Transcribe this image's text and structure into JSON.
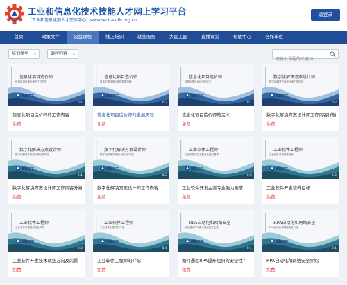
{
  "header": {
    "title": "工业和信息化技术技能人才网上学习平台",
    "subtitle": "（工业和信息化部人才交流中心）www.tech-skills.org.cn",
    "login_label": "请登录"
  },
  "nav": {
    "items": [
      "首页",
      "政策文件",
      "公益课程",
      "线上培训",
      "就业服务",
      "大国工匠",
      "直播课堂",
      "帮助中心",
      "合作单位"
    ],
    "active_index": 2
  },
  "filter": {
    "category": "培训类型",
    "content": "课程内容",
    "search_placeholder": "请输入课程的关键词"
  },
  "courses": [
    {
      "title": "信息化项目造价师的工作内容",
      "price": "免费",
      "thumb_title": "信息化项目造价师",
      "thumb_sub": "信息化项目造价师的工作内容",
      "brand": "网联天下",
      "duration": "0:1",
      "theme": "blue",
      "highlight": false
    },
    {
      "title": "信息化项目造价师的发展历程",
      "price": "免费",
      "thumb_title": "信息化项目造价师",
      "thumb_sub": "信息化项目造价师的发展历程",
      "brand": "网联天下",
      "duration": "0:2",
      "theme": "blue",
      "highlight": true
    },
    {
      "title": "信息化项目造价师的定义",
      "price": "免费",
      "thumb_title": "信息化项目造价师",
      "thumb_sub": "信息化项目造价师的定义",
      "brand": "网联天下",
      "duration": "0:1",
      "theme": "blue",
      "highlight": false
    },
    {
      "title": "数字化解决方案设计师工作内容详解",
      "price": "免费",
      "thumb_title": "数字化解决方案设计师",
      "thumb_sub": "数字化解决方案设计师工作内容",
      "brand": "网联天下",
      "duration": "0:2",
      "theme": "blue",
      "highlight": false
    },
    {
      "title": "数字化解决方案设计师工作内容分析",
      "price": "免费",
      "thumb_title": "数字化解决方案设计师",
      "thumb_sub": "数字化解决方案设计师工作内容",
      "brand": "网联天下",
      "duration": "0:1",
      "theme": "teal",
      "highlight": false
    },
    {
      "title": "数字化解决方案设计师工作内容",
      "price": "免费",
      "thumb_title": "数字化解决方案设计师",
      "thumb_sub": "数字化解决方案设计师工作内容",
      "brand": "网联天下",
      "duration": "0:2",
      "theme": "teal",
      "highlight": false
    },
    {
      "title": "工业软件开发主要专业能力要求",
      "price": "免费",
      "thumb_title": "工业软件工程师",
      "thumb_sub": "工业软件开发主要专业能力要求",
      "brand": "网联天下",
      "duration": "0:2",
      "theme": "teal",
      "highlight": false
    },
    {
      "title": "工业软件开发培养目标",
      "price": "免费",
      "thumb_title": "工业软件工程师",
      "thumb_sub": "工业软件开发培养目标",
      "brand": "网联天下",
      "duration": "0:2",
      "theme": "teal",
      "highlight": false
    },
    {
      "title": "工业软件开发技术就业方向及前景",
      "price": "免费",
      "thumb_title": "工业软件工程师",
      "thumb_sub": "工业软件开发技术就业方向",
      "brand": "网联天下",
      "duration": "0:2",
      "theme": "teal",
      "highlight": false
    },
    {
      "title": "工业软件工程师的介绍",
      "price": "免费",
      "thumb_title": "工业软件工程师",
      "thumb_sub": "工业软件工程师的介绍",
      "brand": "网联天下",
      "duration": "0:1",
      "theme": "teal",
      "highlight": false
    },
    {
      "title": "如何通过RPA提升组织的安全性?",
      "price": "免费",
      "thumb_title": "RPA自动化和网络安全",
      "thumb_sub": "如何通过RPA提升组织的安全性",
      "brand": "网联天下",
      "duration": "0:1",
      "theme": "teal",
      "highlight": false
    },
    {
      "title": "RPA自动化和网络安全介绍",
      "price": "免费",
      "thumb_title": "RPA自动化和网络安全",
      "thumb_sub": "RPA自动化和网络安全介绍",
      "brand": "网联天下",
      "duration": "0:1",
      "theme": "teal",
      "highlight": false
    }
  ],
  "colors": {
    "brand": "#1d55a6",
    "nav": "#1f4e97",
    "nav_active": "#4a78c0",
    "price": "#e4393c"
  }
}
